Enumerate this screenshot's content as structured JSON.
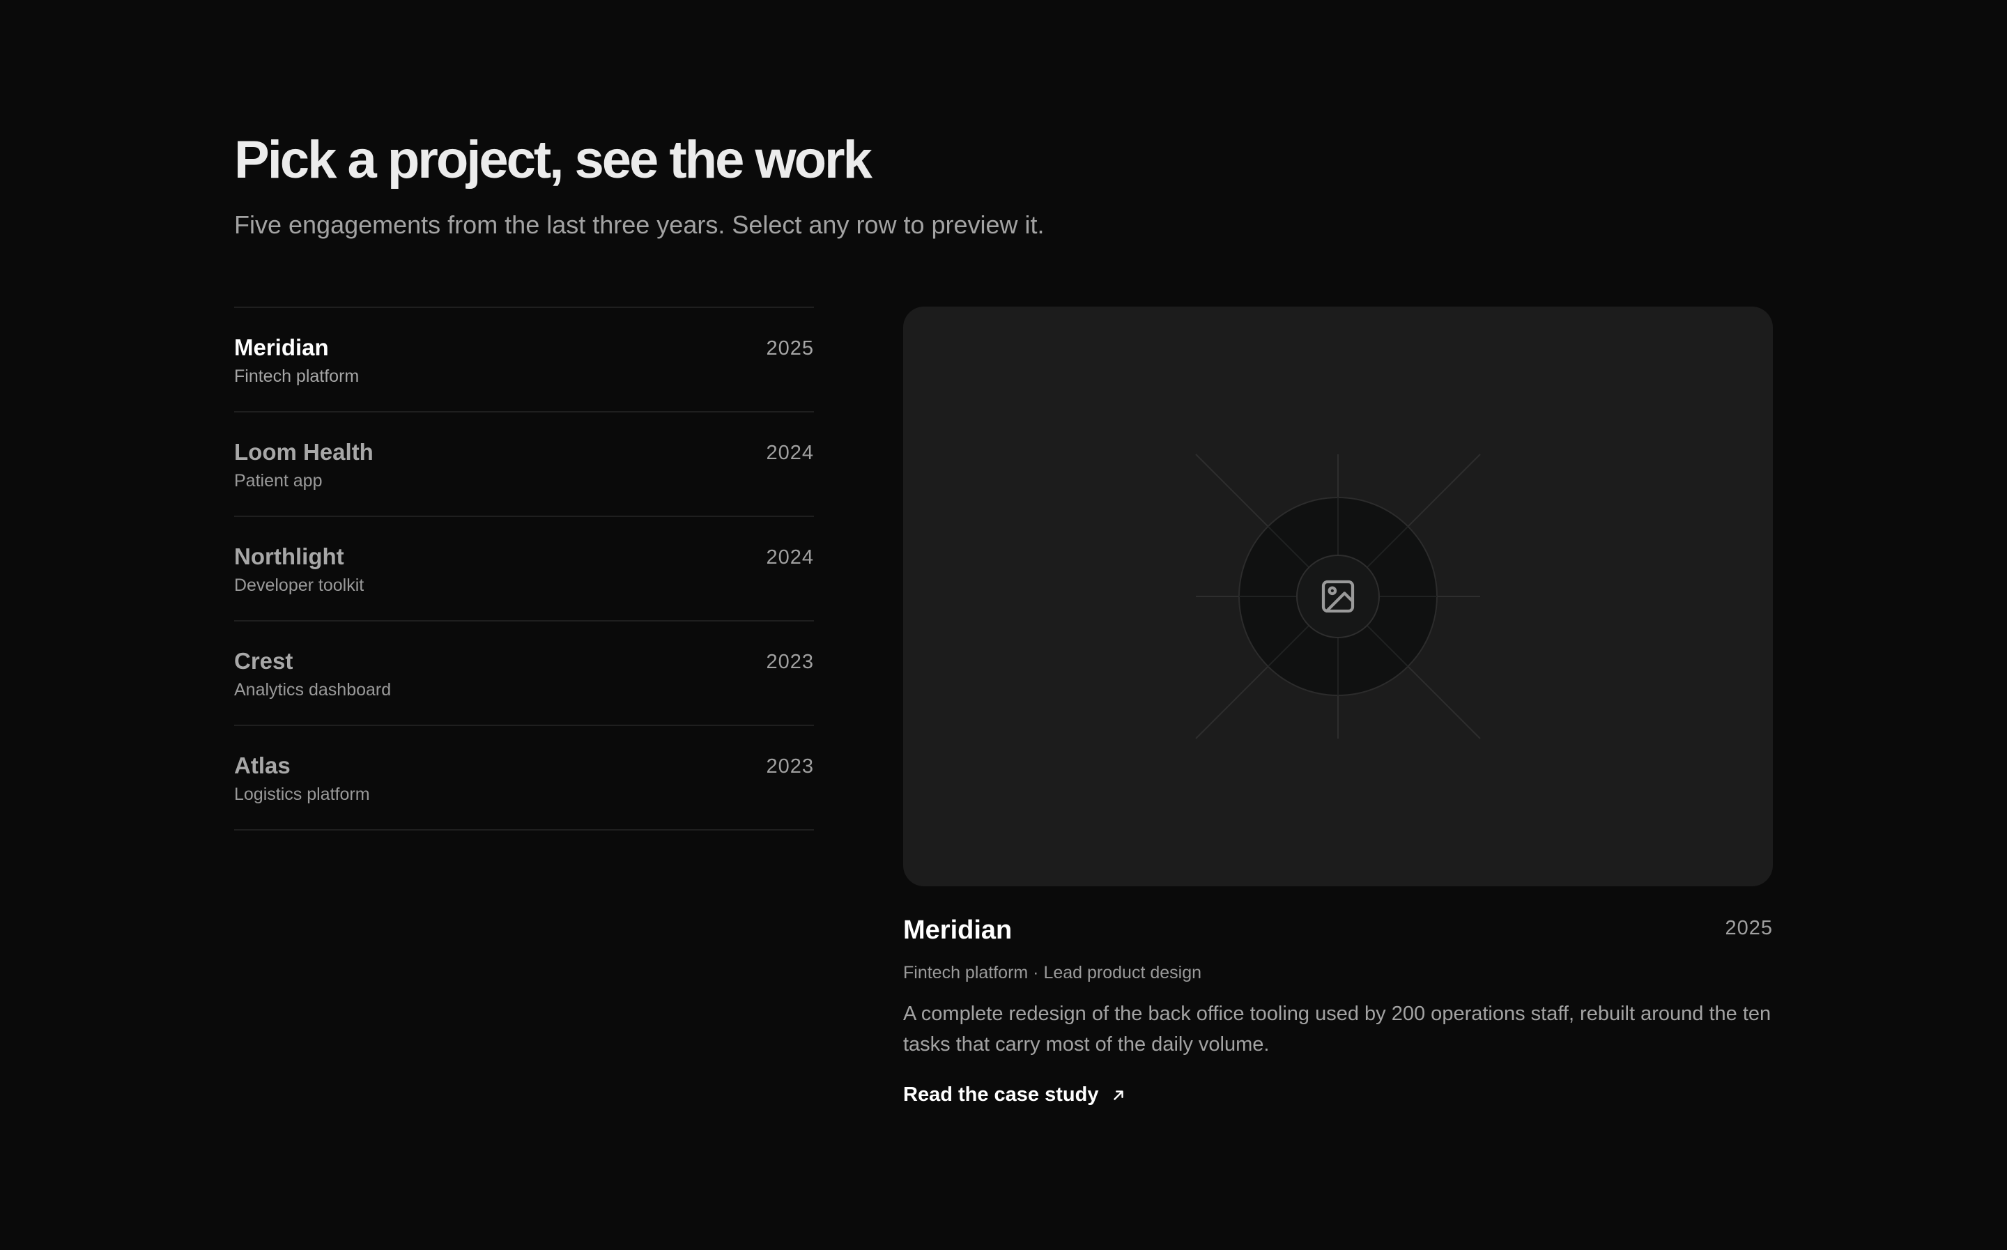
{
  "header": {
    "title": "Pick a project, see the work",
    "subtitle": "Five engagements from the last three years. Select any row to preview it."
  },
  "projects": [
    {
      "name": "Meridian",
      "category": "Fintech platform",
      "year": "2025",
      "active": true
    },
    {
      "name": "Loom Health",
      "category": "Patient app",
      "year": "2024",
      "active": false
    },
    {
      "name": "Northlight",
      "category": "Developer toolkit",
      "year": "2024",
      "active": false
    },
    {
      "name": "Crest",
      "category": "Analytics dashboard",
      "year": "2023",
      "active": false
    },
    {
      "name": "Atlas",
      "category": "Logistics platform",
      "year": "2023",
      "active": false
    }
  ],
  "preview": {
    "name": "Meridian",
    "year": "2025",
    "meta": "Fintech platform · Lead product design",
    "description": "A complete redesign of the back office tooling used by 200 operations staff, rebuilt around the ten tasks that carry most of the daily volume.",
    "cta_label": "Read the case study",
    "image_icon": "image-placeholder-icon",
    "cta_icon": "arrow-up-right-icon"
  },
  "colors": {
    "background": "#0a0a0a",
    "card": "#1c1c1c",
    "text_primary": "#ffffff",
    "text_muted": "#a3a3a3",
    "divider": "#1f1f1f"
  }
}
